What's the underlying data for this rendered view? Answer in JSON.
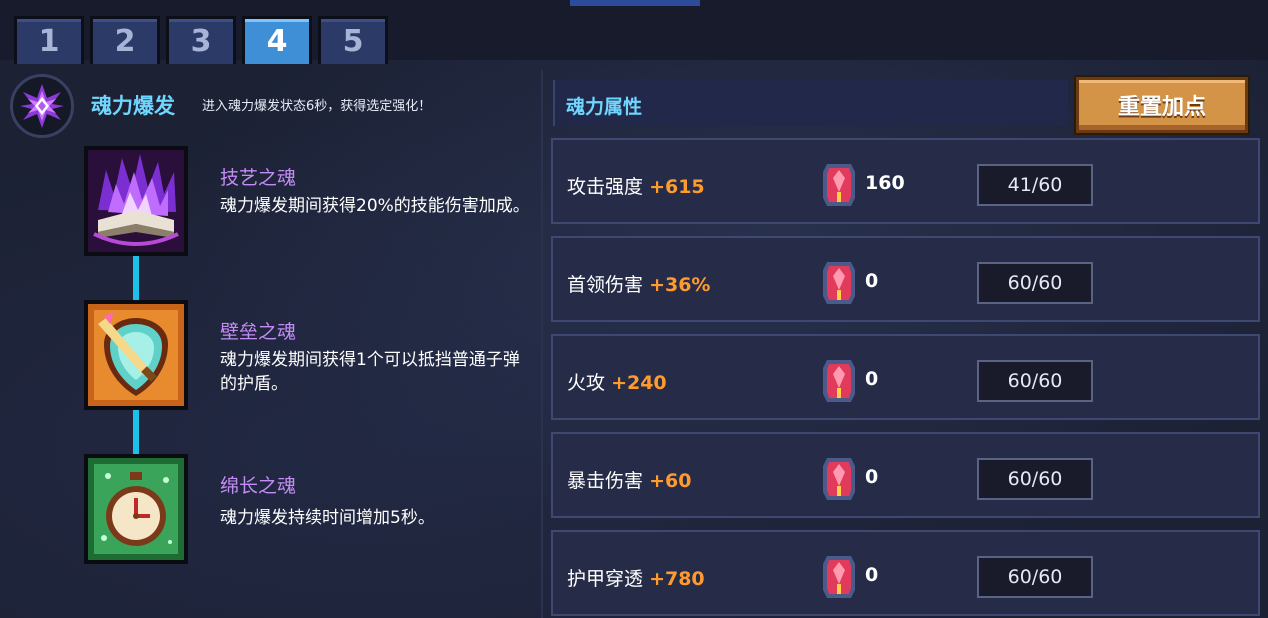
{
  "tabs": [
    "1",
    "2",
    "3",
    "4",
    "5"
  ],
  "active_tab": "4",
  "burst": {
    "title": "魂力爆发",
    "description": "进入魂力爆发状态6秒，获得选定强化！"
  },
  "skills": [
    {
      "name": "技艺之魂",
      "description": "魂力爆发期间获得20%的技能伤害加成。",
      "icon": "purple-flame-book-icon"
    },
    {
      "name": "壁垒之魂",
      "description": "魂力爆发期间获得1个可以抵挡普通子弹的护盾。",
      "icon": "shield-sword-icon"
    },
    {
      "name": "绵长之魂",
      "description": "魂力爆发持续时间增加5秒。",
      "icon": "clock-icon"
    }
  ],
  "attributes_panel": {
    "title": "魂力属性",
    "reset_label": "重置加点"
  },
  "attributes": [
    {
      "name": "攻击强度",
      "bonus": "+615",
      "gems": "160",
      "level": "41/60"
    },
    {
      "name": "首领伤害",
      "bonus": "+36%",
      "gems": "0",
      "level": "60/60"
    },
    {
      "name": "火攻",
      "bonus": "+240",
      "gems": "0",
      "level": "60/60"
    },
    {
      "name": "暴击伤害",
      "bonus": "+60",
      "gems": "0",
      "level": "60/60"
    },
    {
      "name": "护甲穿透",
      "bonus": "+780",
      "gems": "0",
      "level": "60/60"
    }
  ],
  "colors": {
    "accent_cyan": "#6fd6ff",
    "skill_name": "#c48cf5",
    "bonus_orange": "#ff9a2e",
    "active_tab": "#3f8fd6",
    "reset_button": "#d49447"
  }
}
